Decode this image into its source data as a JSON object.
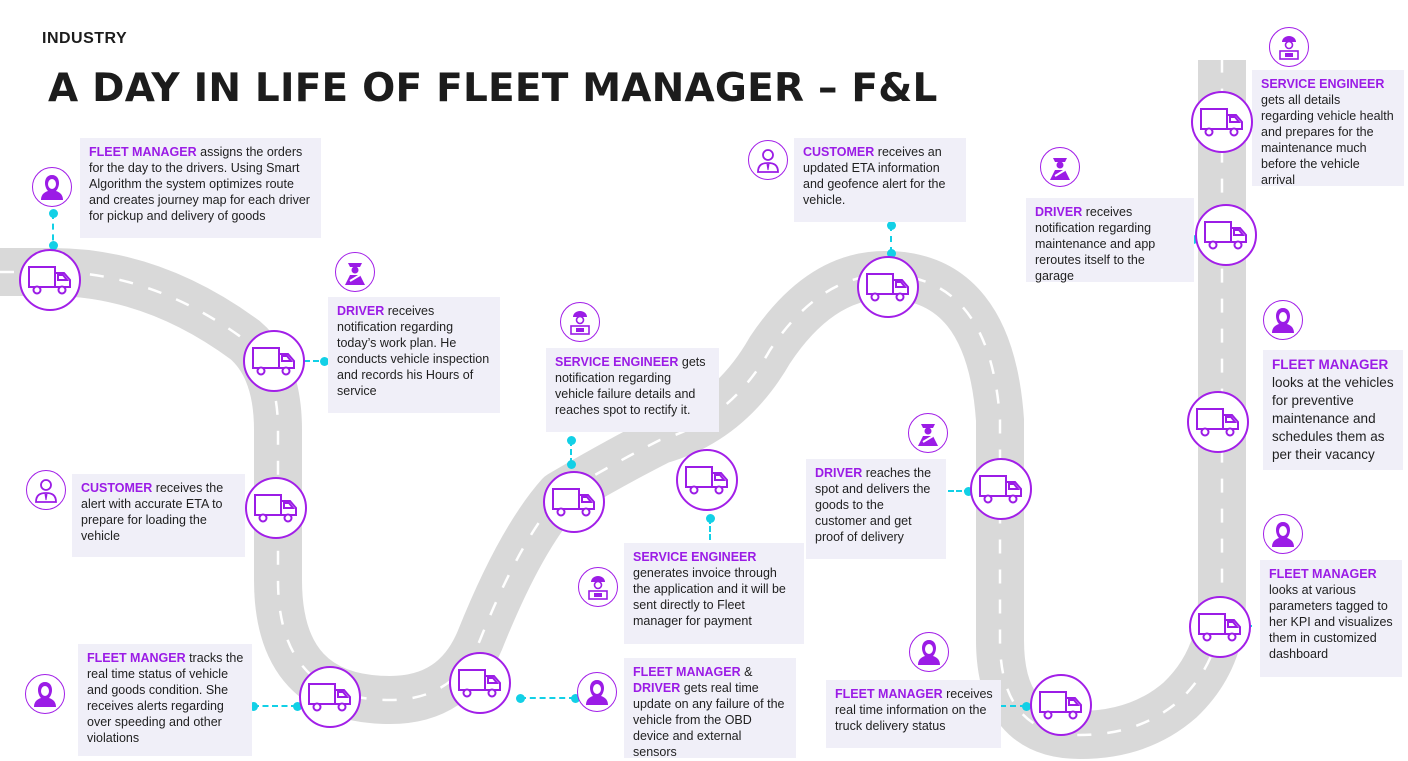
{
  "header": {
    "section": "INDUSTRY",
    "title": "A DAY IN LIFE OF FLEET MANAGER – F&L"
  },
  "colors": {
    "accent": "#9b1ce6",
    "connector": "#12d0e6",
    "road": "#d8d8d8",
    "box": "#f0eff8"
  },
  "steps": [
    {
      "role": "FLEET MANAGER",
      "text": " assigns the orders for the day to the drivers. Using Smart Algorithm the system optimizes route and creates journey map for each driver for pickup and delivery of goods",
      "icon": "fleet-manager-icon"
    },
    {
      "role": "DRIVER",
      "text": " receives notification regarding today’s work plan. He conducts vehicle inspection and records his Hours of service",
      "icon": "driver-icon"
    },
    {
      "role": "CUSTOMER",
      "text": " receives the alert with accurate ETA to prepare for loading the vehicle",
      "icon": "customer-icon"
    },
    {
      "role": "FLEET MANGER",
      "text": " tracks the real time status of vehicle and goods condition. She receives alerts regarding over speeding and other violations",
      "icon": "fleet-manager-icon"
    },
    {
      "role": "SERVICE ENGINEER",
      "text": " gets notification regarding vehicle failure details and reaches spot to rectify it.",
      "icon": "service-engineer-icon"
    },
    {
      "role": "SERVICE ENGINEER",
      "text": " generates invoice through the application and it will be sent directly to Fleet manager for payment",
      "icon": "service-engineer-icon"
    },
    {
      "role": "FLEET MANAGER",
      "role_joiner": " & ",
      "role2": "DRIVER",
      "text": " gets real time update on any failure of the vehicle from the OBD device and external sensors",
      "icon": "fleet-manager-icon"
    },
    {
      "role": "CUSTOMER",
      "text": " receives an updated ETA information and geofence alert for the vehicle.",
      "icon": "customer-icon"
    },
    {
      "role": "DRIVER",
      "text": " reaches the spot and delivers the goods to the customer and get proof of delivery",
      "icon": "driver-icon"
    },
    {
      "role": "FLEET MANAGER",
      "text": " receives real time information on the truck delivery status",
      "icon": "fleet-manager-icon"
    },
    {
      "role": "DRIVER",
      "text": " receives notification regarding maintenance and app reroutes itself to the garage",
      "icon": "driver-icon"
    },
    {
      "role": "SERVICE ENGINEER",
      "text": " gets all details regarding vehicle health and prepares for the maintenance much before the vehicle arrival",
      "icon": "service-engineer-icon"
    },
    {
      "role": "FLEET MANAGER",
      "text": " looks at the vehicles for preventive maintenance and schedules them as per their vacancy",
      "icon": "fleet-manager-icon"
    },
    {
      "role": "FLEET MANAGER",
      "text": " looks at various parameters tagged to her KPI and visualizes them in customized dashboard",
      "icon": "fleet-manager-icon"
    }
  ],
  "truck_icon": "truck-icon"
}
